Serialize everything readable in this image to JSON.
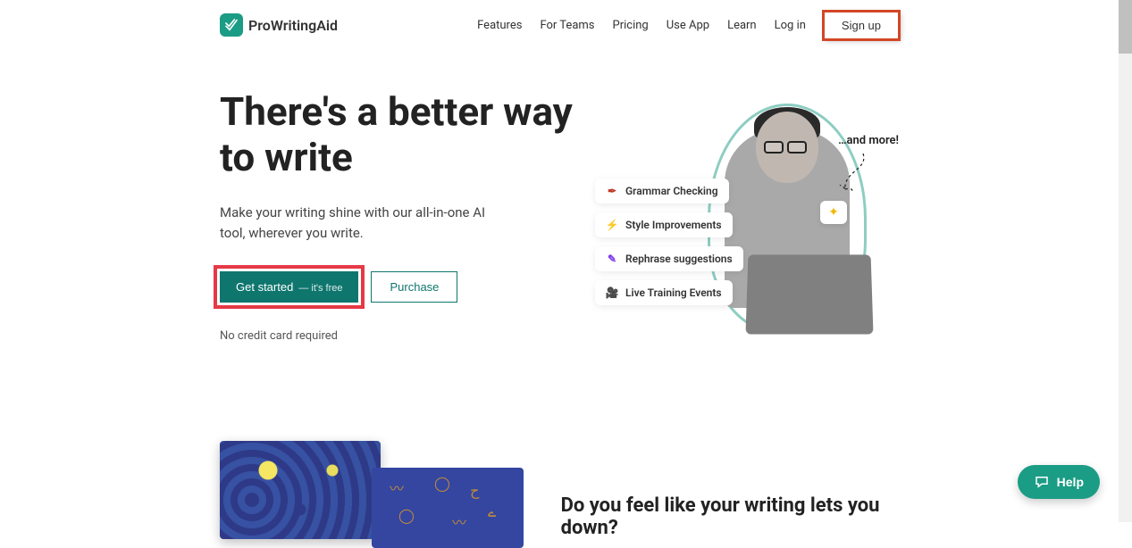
{
  "brand": {
    "name": "ProWritingAid"
  },
  "nav": {
    "features": "Features",
    "forTeams": "For Teams",
    "pricing": "Pricing",
    "useApp": "Use App",
    "learn": "Learn",
    "login": "Log in",
    "signup": "Sign up"
  },
  "hero": {
    "title": "There's a better way to write",
    "subtitle": "Make your writing shine with our all-in-one AI tool, wherever you write.",
    "getStartedLabel": "Get started",
    "getStartedSub": "— it's free",
    "purchaseLabel": "Purchase",
    "noCard": "No credit card required",
    "andMore": "…and more!",
    "pills": {
      "grammar": "Grammar Checking",
      "style": "Style Improvements",
      "rephrase": "Rephrase suggestions",
      "live": "Live Training Events"
    }
  },
  "section2": {
    "title": "Do you feel like your writing lets you down?"
  },
  "help": {
    "label": "Help"
  },
  "colors": {
    "brand": "#1b9c85",
    "primaryBtn": "#0f766e",
    "highlight": "#e63946",
    "highlightOrange": "#d24726"
  }
}
